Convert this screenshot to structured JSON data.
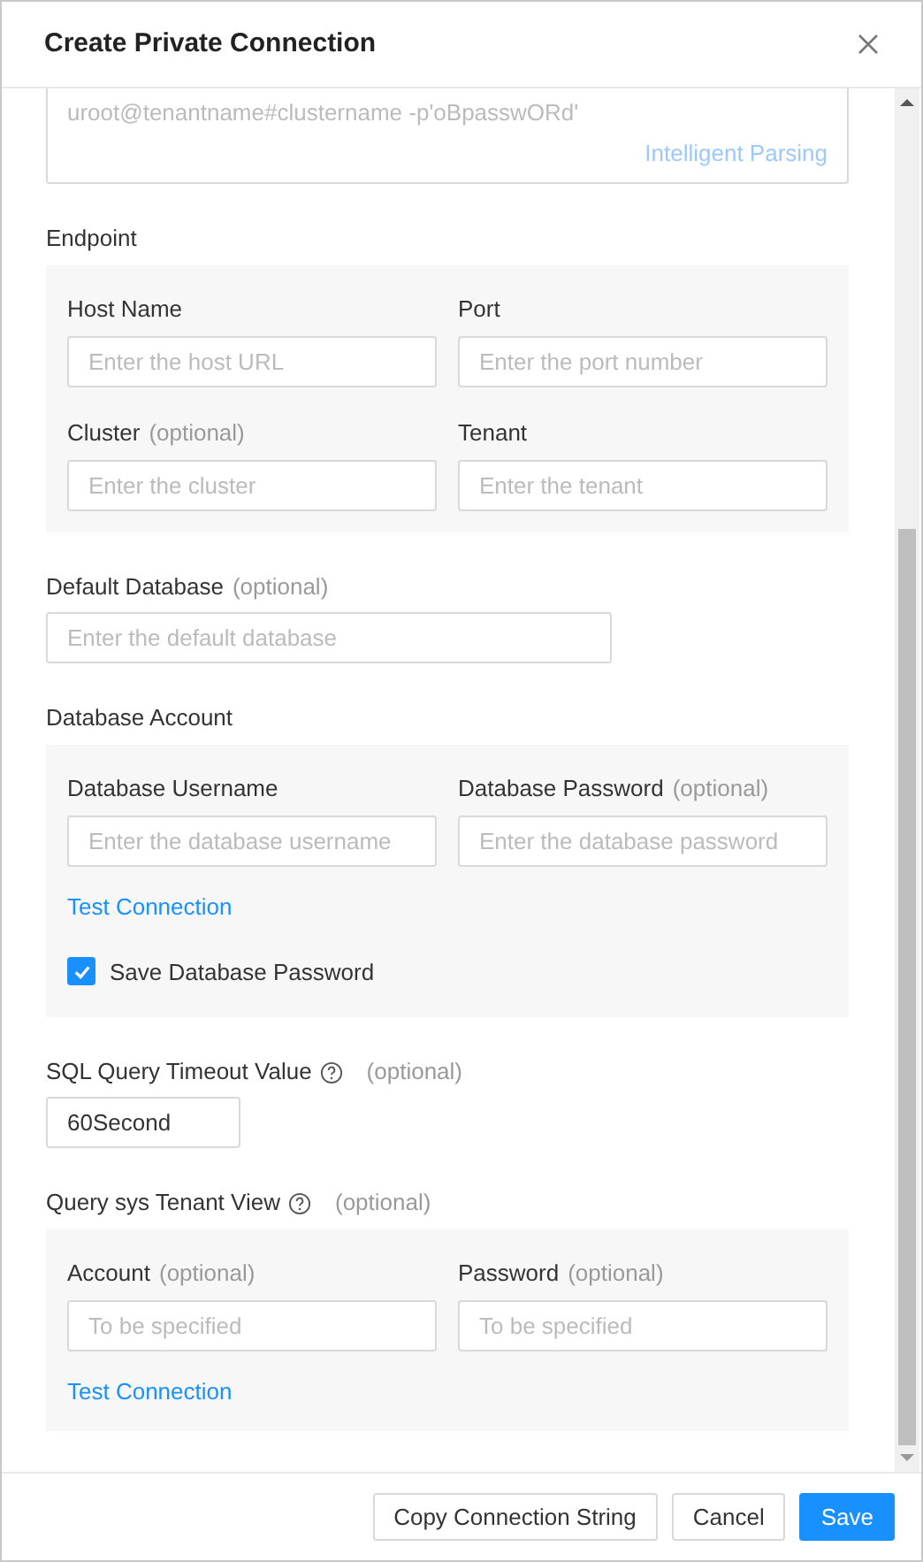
{
  "dialog": {
    "title": "Create Private Connection"
  },
  "parse_box": {
    "text": "uroot@tenantname#clustername -p'oBpasswORd'",
    "action": "Intelligent Parsing"
  },
  "sections": [
    {
      "kind": "panel",
      "label": "Endpoint",
      "items": [
        {
          "kind": "fields",
          "fields": [
            {
              "label": "Host Name",
              "placeholder": "Enter the host URL"
            },
            {
              "label": "Port",
              "placeholder": "Enter the port number"
            }
          ]
        },
        {
          "kind": "fields",
          "fields": [
            {
              "label": "Cluster",
              "hint": "(optional)",
              "placeholder": "Enter the cluster"
            },
            {
              "label": "Tenant",
              "placeholder": "Enter the tenant"
            }
          ]
        }
      ]
    },
    {
      "kind": "field",
      "label": "Default Database",
      "hint": "(optional)",
      "placeholder": "Enter the default database"
    },
    {
      "kind": "panel",
      "label": "Database Account",
      "items": [
        {
          "kind": "fields",
          "fields": [
            {
              "label": "Database Username",
              "placeholder": "Enter the database username"
            },
            {
              "label": "Database Password",
              "hint": "(optional)",
              "placeholder": "Enter the database password"
            }
          ]
        },
        {
          "kind": "link",
          "text": "Test Connection"
        },
        {
          "kind": "checkbox",
          "label": "Save Database Password",
          "checked": true
        }
      ]
    },
    {
      "kind": "number",
      "label": "SQL Query Timeout Value",
      "help": true,
      "hint": "(optional)",
      "value": "60Second"
    },
    {
      "kind": "panel",
      "label": "Query sys Tenant View",
      "help": true,
      "hint": "(optional)",
      "items": [
        {
          "kind": "fields",
          "fields": [
            {
              "label": "Account",
              "hint": "(optional)",
              "placeholder": "To be specified"
            },
            {
              "label": "Password",
              "hint": "(optional)",
              "placeholder": "To be specified"
            }
          ]
        },
        {
          "kind": "link",
          "text": "Test Connection"
        }
      ]
    }
  ],
  "footer": {
    "buttons": [
      {
        "label": "Copy Connection String",
        "kind": "default"
      },
      {
        "label": "Cancel",
        "kind": "default"
      },
      {
        "label": "Save",
        "kind": "primary"
      }
    ]
  }
}
